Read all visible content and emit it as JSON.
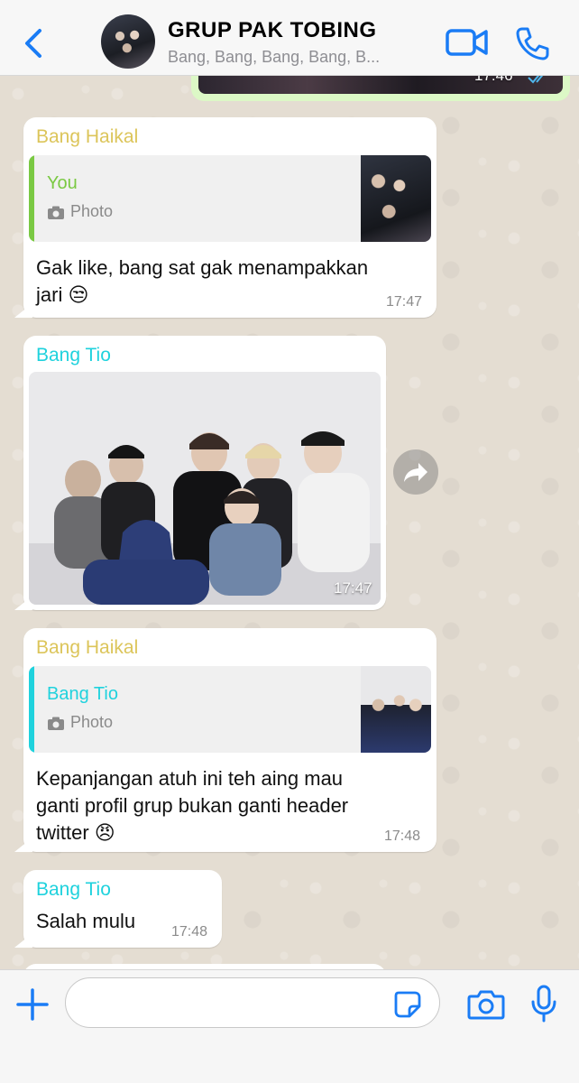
{
  "header": {
    "title": "GRUP PAK TOBING",
    "members": "Bang, Bang, Bang, Bang, B..."
  },
  "messages": {
    "prev_outgoing": {
      "time": "17:46"
    },
    "m1": {
      "sender": "Bang Haikal",
      "quote_name": "You",
      "quote_type": "Photo",
      "text_line1": "Gak like, bang sat gak menampakkan",
      "text_line2": "jari 😒",
      "time": "17:47"
    },
    "m2": {
      "sender": "Bang Tio",
      "time": "17:47"
    },
    "m3": {
      "sender": "Bang Haikal",
      "quote_name": "Bang Tio",
      "quote_type": "Photo",
      "text_line1": "Kepanjangan atuh ini teh aing mau",
      "text_line2": "ganti profil grup bukan ganti header",
      "text_line3": "twitter 😠",
      "time": "17:48"
    },
    "m4": {
      "sender": "Bang Tio",
      "text": "Salah mulu",
      "time": "17:48"
    }
  },
  "input": {
    "placeholder": ""
  },
  "colors": {
    "accent": "#1a7cf5",
    "sender_yellow": "#dcc55a",
    "sender_cyan": "#1fd2dd",
    "quote_you": "#7ac943",
    "quote_tio": "#1fd2dd"
  }
}
